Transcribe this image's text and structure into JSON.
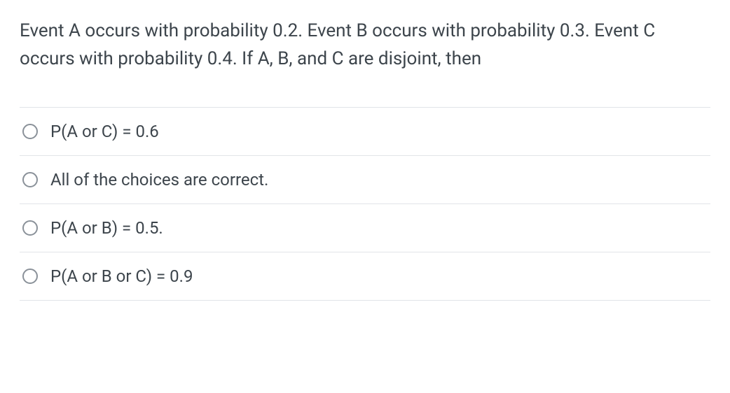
{
  "question": {
    "stem": "Event A occurs with probability 0.2.   Event B occurs with probability 0.3.   Event C occurs with probability 0.4. If A, B, and C are disjoint, then"
  },
  "options": [
    {
      "label": "P(A or C) = 0.6"
    },
    {
      "label": "All of the choices are correct."
    },
    {
      "label": "P(A or B) = 0.5."
    },
    {
      "label": "P(A or B or C) = 0.9"
    }
  ]
}
